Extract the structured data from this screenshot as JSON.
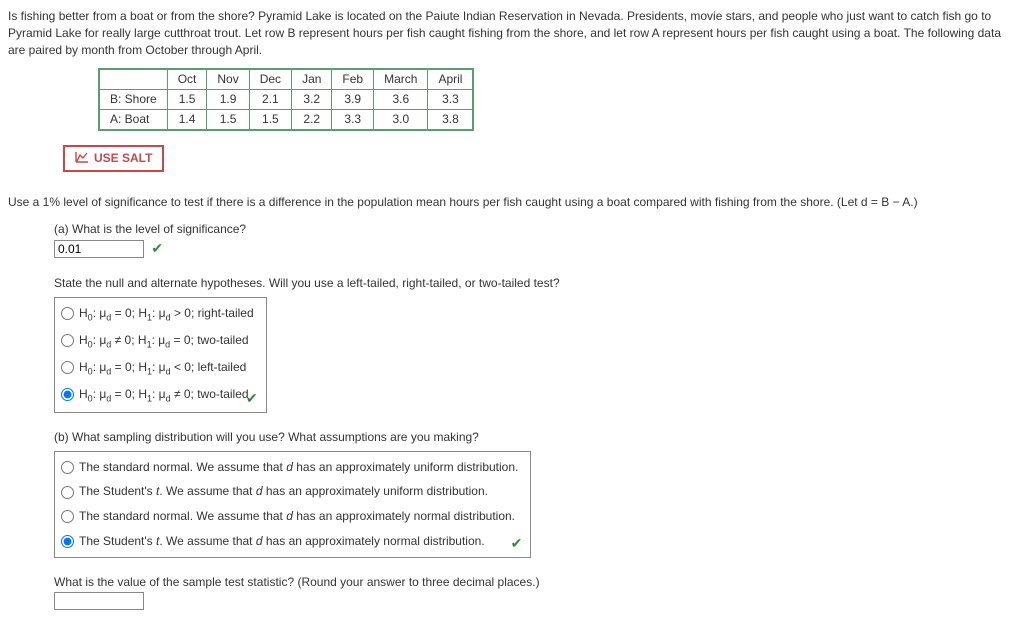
{
  "intro": "Is fishing better from a boat or from the shore? Pyramid Lake is located on the Paiute Indian Reservation in Nevada. Presidents, movie stars, and people who just want to catch fish go to Pyramid Lake for really large cutthroat trout. Let row B represent hours per fish caught fishing from the shore, and let row A represent hours per fish caught using a boat. The following data are paired by month from October through April.",
  "dataTable": {
    "months": [
      "Oct",
      "Nov",
      "Dec",
      "Jan",
      "Feb",
      "March",
      "April"
    ],
    "rows": [
      {
        "label": "B: Shore",
        "vals": [
          "1.5",
          "1.9",
          "2.1",
          "3.2",
          "3.9",
          "3.6",
          "3.3"
        ]
      },
      {
        "label": "A: Boat",
        "vals": [
          "1.4",
          "1.5",
          "1.5",
          "2.2",
          "3.3",
          "3.0",
          "3.8"
        ]
      }
    ]
  },
  "saltLabel": "USE SALT",
  "mainQ": "Use a 1% level of significance to test if there is a difference in the population mean hours per fish caught using a boat compared with fishing from the shore. (Let d = B − A.)",
  "partA": {
    "prompt": "(a) What is the level of significance?",
    "value": "0.01",
    "hypPrompt": "State the null and alternate hypotheses. Will you use a left-tailed, right-tailed, or two-tailed test?",
    "options": [
      {
        "html": "H<sub>0</sub>: μ<sub>d</sub> = 0; H<sub>1</sub>: μ<sub>d</sub> > 0; right-tailed",
        "sel": false
      },
      {
        "html": "H<sub>0</sub>: μ<sub>d</sub> ≠ 0; H<sub>1</sub>: μ<sub>d</sub> = 0; two-tailed",
        "sel": false
      },
      {
        "html": "H<sub>0</sub>: μ<sub>d</sub> = 0; H<sub>1</sub>: μ<sub>d</sub> < 0; left-tailed",
        "sel": false
      },
      {
        "html": "H<sub>0</sub>: μ<sub>d</sub> = 0; H<sub>1</sub>: μ<sub>d</sub> ≠ 0; two-tailed",
        "sel": true
      }
    ]
  },
  "partB": {
    "prompt": "(b) What sampling distribution will you use? What assumptions are you making?",
    "options": [
      {
        "html": "The standard normal. We assume that <i>d</i> has an approximately uniform distribution.",
        "sel": false
      },
      {
        "html": "The Student's <i>t</i>. We assume that <i>d</i> has an approximately uniform distribution.",
        "sel": false
      },
      {
        "html": "The standard normal. We assume that <i>d</i> has an approximately normal distribution.",
        "sel": false
      },
      {
        "html": "The Student's <i>t</i>. We assume that <i>d</i> has an approximately normal distribution.",
        "sel": true
      }
    ]
  },
  "statPrompt": "What is the value of the sample test statistic? (Round your answer to three decimal places.)"
}
